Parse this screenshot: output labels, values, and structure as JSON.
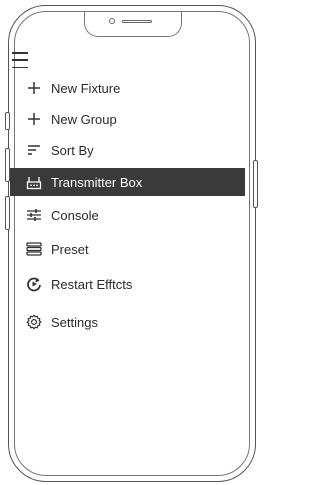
{
  "menu": {
    "toggle_icon": "hamburger-icon",
    "items": [
      {
        "label": "New Fixture",
        "icon": "plus-icon",
        "active": false
      },
      {
        "label": "New Group",
        "icon": "plus-icon",
        "active": false
      },
      {
        "label": "Sort By",
        "icon": "sort-icon",
        "active": false
      },
      {
        "label": "Transmitter Box",
        "icon": "transmitter-box-icon",
        "active": true
      },
      {
        "label": "Console",
        "icon": "sliders-icon",
        "active": false
      },
      {
        "label": "Preset",
        "icon": "preset-icon",
        "active": false
      },
      {
        "label": "Restart Efftcts",
        "icon": "restart-icon",
        "active": false
      },
      {
        "label": "Settings",
        "icon": "gear-icon",
        "active": false
      }
    ]
  },
  "colors": {
    "active_bg": "#3a3a3a",
    "active_text": "#ffffff",
    "text": "#2b2b2b",
    "frame": "#555555"
  }
}
